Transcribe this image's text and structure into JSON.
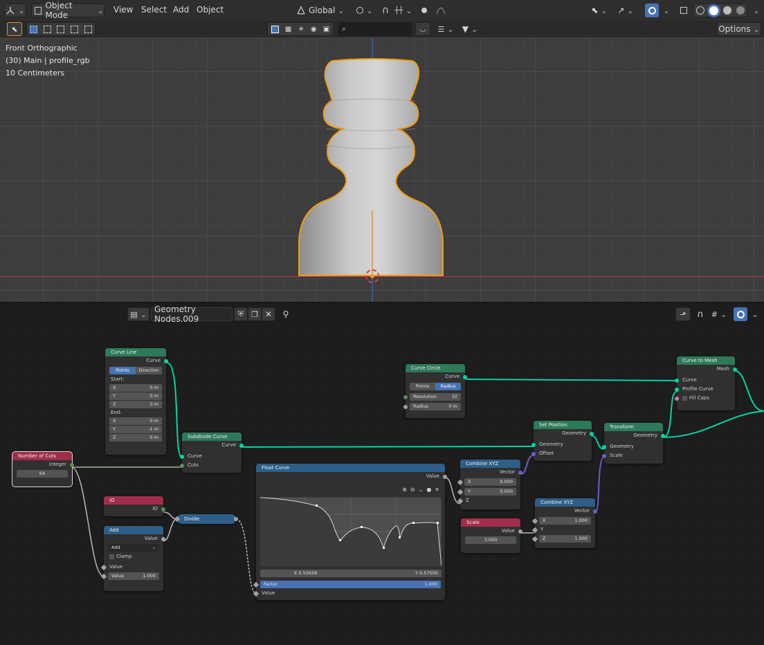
{
  "header": {
    "mode": "Object Mode",
    "menus": [
      "View",
      "Select",
      "Add",
      "Object"
    ],
    "transform_orientation": "Global",
    "options": "Options"
  },
  "viewport": {
    "view_name": "Front Orthographic",
    "collection": "(30) Main | profile_rgb",
    "scale": "10 Centimeters"
  },
  "node_editor": {
    "tree_name": "Geometry Nodes.009"
  },
  "nodes": {
    "curve_line": {
      "title": "Curve Line",
      "out": "Curve",
      "mode": [
        "Points",
        "Direction"
      ],
      "start_label": "Start:",
      "start": [
        [
          "X",
          "0 m"
        ],
        [
          "Y",
          "0 m"
        ],
        [
          "Z",
          "0 m"
        ]
      ],
      "end_label": "End:",
      "end": [
        [
          "X",
          "0 m"
        ],
        [
          "Y",
          "-1 m"
        ],
        [
          "Z",
          "0 m"
        ]
      ]
    },
    "number_of_cuts": {
      "title": "Number of Cuts",
      "out": "Integer",
      "value": "64"
    },
    "subdivide": {
      "title": "Subdivide Curve",
      "out": "Curve",
      "in1": "Curve",
      "in2": "Cuts"
    },
    "curve_circle": {
      "title": "Curve Circle",
      "out": "Curve",
      "mode": [
        "Points",
        "Radius"
      ],
      "resolution": [
        "Resolution",
        "32"
      ],
      "radius": [
        "Radius",
        "0 m"
      ]
    },
    "curve_to_mesh": {
      "title": "Curve to Mesh",
      "out": "Mesh",
      "in1": "Curve",
      "in2": "Profile Curve",
      "fill": "Fill Caps"
    },
    "set_position": {
      "title": "Set Position",
      "out": "Geometry",
      "in1": "Geometry",
      "in2": "Offset"
    },
    "transform": {
      "title": "Transform",
      "out": "Geometry",
      "in1": "Geometry",
      "in2": "Scale"
    },
    "combine1": {
      "title": "Combine XYZ",
      "out": "Vector",
      "x": [
        "X",
        "0.000"
      ],
      "y": [
        "Y",
        "0.000"
      ],
      "z": "Z"
    },
    "combine2": {
      "title": "Combine XYZ",
      "out": "Vector",
      "x": [
        "X",
        "1.000"
      ],
      "y": "Y",
      "z": [
        "Z",
        "1.000"
      ]
    },
    "scale": {
      "title": "Scale",
      "out": "Value",
      "value": "3.000"
    },
    "float_curve": {
      "title": "Float Curve",
      "out": "Value",
      "x_readout": "X 0.55628",
      "y_readout": "Y 0.57500",
      "factor": [
        "Factor",
        "1.000"
      ],
      "in": "Value"
    },
    "id": {
      "title": "ID",
      "out": "ID"
    },
    "add": {
      "title": "Add",
      "out": "Value",
      "op": "Add",
      "clamp": "Clamp",
      "in": "Value",
      "value": [
        "Value",
        "1.000"
      ]
    },
    "divide": {
      "title": "Divide"
    }
  },
  "colors": {
    "geometry_socket": "#00d6a3",
    "vector_socket": "#6363c7",
    "selection_outline": "#f39c12",
    "accent": "#4772b3"
  }
}
